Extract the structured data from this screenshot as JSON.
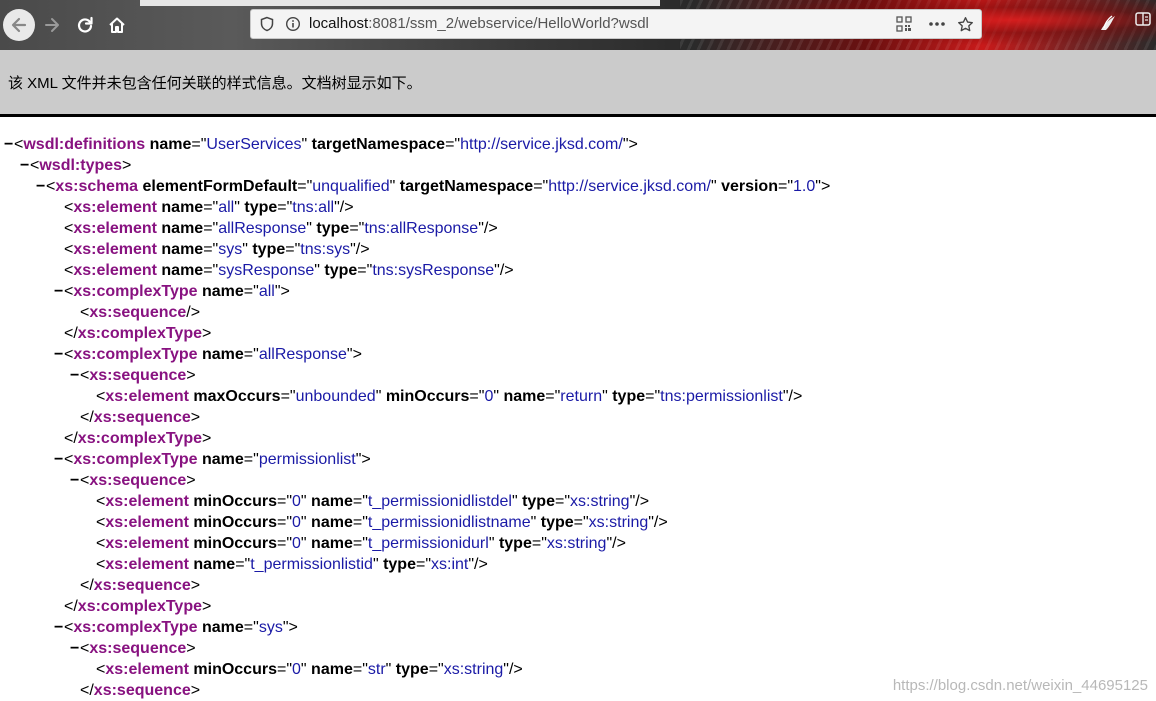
{
  "browser": {
    "url_prefix": "localhost",
    "url_rest": ":8081/ssm_2/webservice/HelloWorld?wsdl"
  },
  "notice": "该 XML 文件并未包含任何关联的样式信息。文档树显示如下。",
  "xml_lines": [
    {
      "t": "−",
      "parts": [
        [
          "p",
          "<"
        ],
        [
          "tag",
          "wsdl:definitions"
        ],
        [
          "p",
          " "
        ],
        [
          "attr",
          "name"
        ],
        [
          "p",
          "=\""
        ],
        [
          "val",
          "UserServices"
        ],
        [
          "p",
          "\" "
        ],
        [
          "attr",
          "targetNamespace"
        ],
        [
          "p",
          "=\""
        ],
        [
          "val",
          "http://service.jksd.com/"
        ],
        [
          "p",
          "\">"
        ]
      ]
    },
    {
      "t": "−",
      "parts": [
        [
          "p",
          "<"
        ],
        [
          "tag",
          "wsdl:types"
        ],
        [
          "p",
          ">"
        ]
      ]
    },
    {
      "t": "−",
      "parts": [
        [
          "p",
          "<"
        ],
        [
          "tag",
          "xs:schema"
        ],
        [
          "p",
          " "
        ],
        [
          "attr",
          "elementFormDefault"
        ],
        [
          "p",
          "=\""
        ],
        [
          "val",
          "unqualified"
        ],
        [
          "p",
          "\" "
        ],
        [
          "attr",
          "targetNamespace"
        ],
        [
          "p",
          "=\""
        ],
        [
          "val",
          "http://service.jksd.com/"
        ],
        [
          "p",
          "\" "
        ],
        [
          "attr",
          "version"
        ],
        [
          "p",
          "=\""
        ],
        [
          "val",
          "1.0"
        ],
        [
          "p",
          "\">"
        ]
      ]
    },
    {
      "t": "",
      "parts": [
        [
          "p",
          "<"
        ],
        [
          "tag",
          "xs:element"
        ],
        [
          "p",
          " "
        ],
        [
          "attr",
          "name"
        ],
        [
          "p",
          "=\""
        ],
        [
          "val",
          "all"
        ],
        [
          "p",
          "\" "
        ],
        [
          "attr",
          "type"
        ],
        [
          "p",
          "=\""
        ],
        [
          "val",
          "tns:all"
        ],
        [
          "p",
          "\"/>"
        ]
      ]
    },
    {
      "t": "",
      "parts": [
        [
          "p",
          "<"
        ],
        [
          "tag",
          "xs:element"
        ],
        [
          "p",
          " "
        ],
        [
          "attr",
          "name"
        ],
        [
          "p",
          "=\""
        ],
        [
          "val",
          "allResponse"
        ],
        [
          "p",
          "\" "
        ],
        [
          "attr",
          "type"
        ],
        [
          "p",
          "=\""
        ],
        [
          "val",
          "tns:allResponse"
        ],
        [
          "p",
          "\"/>"
        ]
      ]
    },
    {
      "t": "",
      "parts": [
        [
          "p",
          "<"
        ],
        [
          "tag",
          "xs:element"
        ],
        [
          "p",
          " "
        ],
        [
          "attr",
          "name"
        ],
        [
          "p",
          "=\""
        ],
        [
          "val",
          "sys"
        ],
        [
          "p",
          "\" "
        ],
        [
          "attr",
          "type"
        ],
        [
          "p",
          "=\""
        ],
        [
          "val",
          "tns:sys"
        ],
        [
          "p",
          "\"/>"
        ]
      ]
    },
    {
      "t": "",
      "parts": [
        [
          "p",
          "<"
        ],
        [
          "tag",
          "xs:element"
        ],
        [
          "p",
          " "
        ],
        [
          "attr",
          "name"
        ],
        [
          "p",
          "=\""
        ],
        [
          "val",
          "sysResponse"
        ],
        [
          "p",
          "\" "
        ],
        [
          "attr",
          "type"
        ],
        [
          "p",
          "=\""
        ],
        [
          "val",
          "tns:sysResponse"
        ],
        [
          "p",
          "\"/>"
        ]
      ]
    },
    {
      "t": "−",
      "parts": [
        [
          "p",
          "<"
        ],
        [
          "tag",
          "xs:complexType"
        ],
        [
          "p",
          " "
        ],
        [
          "attr",
          "name"
        ],
        [
          "p",
          "=\""
        ],
        [
          "val",
          "all"
        ],
        [
          "p",
          "\">"
        ]
      ]
    },
    {
      "t": "",
      "parts": [
        [
          "p",
          "<"
        ],
        [
          "tag",
          "xs:sequence"
        ],
        [
          "p",
          "/>"
        ]
      ]
    },
    {
      "t": "",
      "parts": [
        [
          "p",
          "</"
        ],
        [
          "tag",
          "xs:complexType"
        ],
        [
          "p",
          ">"
        ]
      ]
    },
    {
      "t": "−",
      "parts": [
        [
          "p",
          "<"
        ],
        [
          "tag",
          "xs:complexType"
        ],
        [
          "p",
          " "
        ],
        [
          "attr",
          "name"
        ],
        [
          "p",
          "=\""
        ],
        [
          "val",
          "allResponse"
        ],
        [
          "p",
          "\">"
        ]
      ]
    },
    {
      "t": "−",
      "parts": [
        [
          "p",
          "<"
        ],
        [
          "tag",
          "xs:sequence"
        ],
        [
          "p",
          ">"
        ]
      ]
    },
    {
      "t": "",
      "parts": [
        [
          "p",
          "<"
        ],
        [
          "tag",
          "xs:element"
        ],
        [
          "p",
          " "
        ],
        [
          "attr",
          "maxOccurs"
        ],
        [
          "p",
          "=\""
        ],
        [
          "val",
          "unbounded"
        ],
        [
          "p",
          "\" "
        ],
        [
          "attr",
          "minOccurs"
        ],
        [
          "p",
          "=\""
        ],
        [
          "val",
          "0"
        ],
        [
          "p",
          "\" "
        ],
        [
          "attr",
          "name"
        ],
        [
          "p",
          "=\""
        ],
        [
          "val",
          "return"
        ],
        [
          "p",
          "\" "
        ],
        [
          "attr",
          "type"
        ],
        [
          "p",
          "=\""
        ],
        [
          "val",
          "tns:permissionlist"
        ],
        [
          "p",
          "\"/>"
        ]
      ]
    },
    {
      "t": "",
      "parts": [
        [
          "p",
          "</"
        ],
        [
          "tag",
          "xs:sequence"
        ],
        [
          "p",
          ">"
        ]
      ]
    },
    {
      "t": "",
      "parts": [
        [
          "p",
          "</"
        ],
        [
          "tag",
          "xs:complexType"
        ],
        [
          "p",
          ">"
        ]
      ]
    },
    {
      "t": "−",
      "parts": [
        [
          "p",
          "<"
        ],
        [
          "tag",
          "xs:complexType"
        ],
        [
          "p",
          " "
        ],
        [
          "attr",
          "name"
        ],
        [
          "p",
          "=\""
        ],
        [
          "val",
          "permissionlist"
        ],
        [
          "p",
          "\">"
        ]
      ]
    },
    {
      "t": "−",
      "parts": [
        [
          "p",
          "<"
        ],
        [
          "tag",
          "xs:sequence"
        ],
        [
          "p",
          ">"
        ]
      ]
    },
    {
      "t": "",
      "parts": [
        [
          "p",
          "<"
        ],
        [
          "tag",
          "xs:element"
        ],
        [
          "p",
          " "
        ],
        [
          "attr",
          "minOccurs"
        ],
        [
          "p",
          "=\""
        ],
        [
          "val",
          "0"
        ],
        [
          "p",
          "\" "
        ],
        [
          "attr",
          "name"
        ],
        [
          "p",
          "=\""
        ],
        [
          "val",
          "t_permissionidlistdel"
        ],
        [
          "p",
          "\" "
        ],
        [
          "attr",
          "type"
        ],
        [
          "p",
          "=\""
        ],
        [
          "val",
          "xs:string"
        ],
        [
          "p",
          "\"/>"
        ]
      ]
    },
    {
      "t": "",
      "parts": [
        [
          "p",
          "<"
        ],
        [
          "tag",
          "xs:element"
        ],
        [
          "p",
          " "
        ],
        [
          "attr",
          "minOccurs"
        ],
        [
          "p",
          "=\""
        ],
        [
          "val",
          "0"
        ],
        [
          "p",
          "\" "
        ],
        [
          "attr",
          "name"
        ],
        [
          "p",
          "=\""
        ],
        [
          "val",
          "t_permissionidlistname"
        ],
        [
          "p",
          "\" "
        ],
        [
          "attr",
          "type"
        ],
        [
          "p",
          "=\""
        ],
        [
          "val",
          "xs:string"
        ],
        [
          "p",
          "\"/>"
        ]
      ]
    },
    {
      "t": "",
      "parts": [
        [
          "p",
          "<"
        ],
        [
          "tag",
          "xs:element"
        ],
        [
          "p",
          " "
        ],
        [
          "attr",
          "minOccurs"
        ],
        [
          "p",
          "=\""
        ],
        [
          "val",
          "0"
        ],
        [
          "p",
          "\" "
        ],
        [
          "attr",
          "name"
        ],
        [
          "p",
          "=\""
        ],
        [
          "val",
          "t_permissionidurl"
        ],
        [
          "p",
          "\" "
        ],
        [
          "attr",
          "type"
        ],
        [
          "p",
          "=\""
        ],
        [
          "val",
          "xs:string"
        ],
        [
          "p",
          "\"/>"
        ]
      ]
    },
    {
      "t": "",
      "parts": [
        [
          "p",
          "<"
        ],
        [
          "tag",
          "xs:element"
        ],
        [
          "p",
          " "
        ],
        [
          "attr",
          "name"
        ],
        [
          "p",
          "=\""
        ],
        [
          "val",
          "t_permissionlistid"
        ],
        [
          "p",
          "\" "
        ],
        [
          "attr",
          "type"
        ],
        [
          "p",
          "=\""
        ],
        [
          "val",
          "xs:int"
        ],
        [
          "p",
          "\"/>"
        ]
      ]
    },
    {
      "t": "",
      "parts": [
        [
          "p",
          "</"
        ],
        [
          "tag",
          "xs:sequence"
        ],
        [
          "p",
          ">"
        ]
      ]
    },
    {
      "t": "",
      "parts": [
        [
          "p",
          "</"
        ],
        [
          "tag",
          "xs:complexType"
        ],
        [
          "p",
          ">"
        ]
      ]
    },
    {
      "t": "−",
      "parts": [
        [
          "p",
          "<"
        ],
        [
          "tag",
          "xs:complexType"
        ],
        [
          "p",
          " "
        ],
        [
          "attr",
          "name"
        ],
        [
          "p",
          "=\""
        ],
        [
          "val",
          "sys"
        ],
        [
          "p",
          "\">"
        ]
      ]
    },
    {
      "t": "−",
      "parts": [
        [
          "p",
          "<"
        ],
        [
          "tag",
          "xs:sequence"
        ],
        [
          "p",
          ">"
        ]
      ]
    },
    {
      "t": "",
      "parts": [
        [
          "p",
          "<"
        ],
        [
          "tag",
          "xs:element"
        ],
        [
          "p",
          " "
        ],
        [
          "attr",
          "minOccurs"
        ],
        [
          "p",
          "=\""
        ],
        [
          "val",
          "0"
        ],
        [
          "p",
          "\" "
        ],
        [
          "attr",
          "name"
        ],
        [
          "p",
          "=\""
        ],
        [
          "val",
          "str"
        ],
        [
          "p",
          "\" "
        ],
        [
          "attr",
          "type"
        ],
        [
          "p",
          "=\""
        ],
        [
          "val",
          "xs:string"
        ],
        [
          "p",
          "\"/>"
        ]
      ]
    },
    {
      "t": "",
      "parts": [
        [
          "p",
          "</"
        ],
        [
          "tag",
          "xs:sequence"
        ],
        [
          "p",
          ">"
        ]
      ]
    }
  ],
  "watermark": "https://blog.csdn.net/weixin_44695125"
}
